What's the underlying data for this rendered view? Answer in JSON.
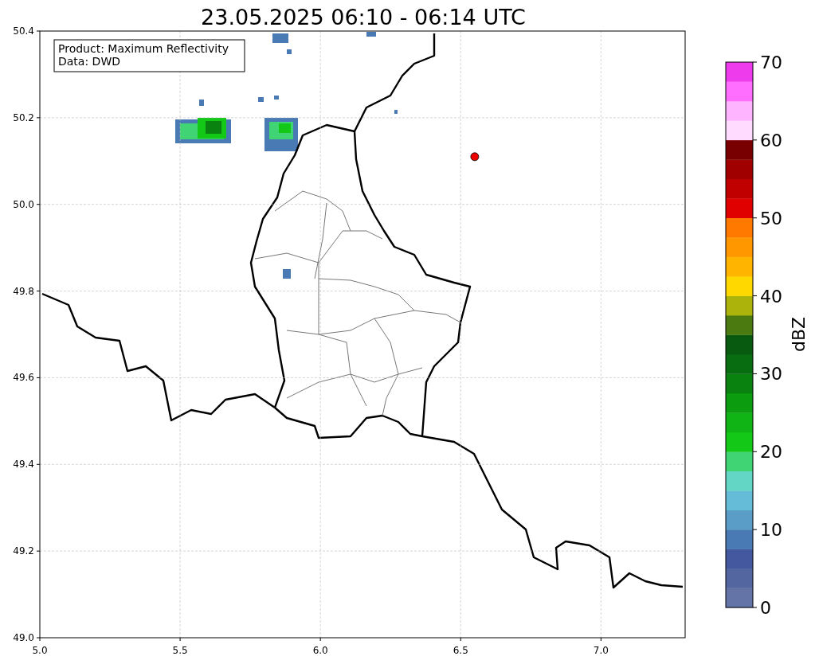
{
  "title": "23.05.2025 06:10 - 06:14 UTC",
  "info_box": {
    "lines": [
      "Product: Maximum Reflectivity",
      "Data: DWD"
    ]
  },
  "map": {
    "chart_data": {
      "type": "scatter",
      "grid": true,
      "x": [
        6.55
      ],
      "values": [
        50.11
      ],
      "xlim": [
        5.0,
        7.3
      ],
      "ylim": [
        49.0,
        50.4
      ],
      "xticks": [
        {
          "value": 5.0,
          "label": "5.0"
        },
        {
          "value": 5.5,
          "label": "5.5"
        },
        {
          "value": 6.0,
          "label": "6.0"
        },
        {
          "value": 6.5,
          "label": "6.5"
        },
        {
          "value": 7.0,
          "label": "7.0"
        }
      ],
      "yticks": [
        {
          "value": 49.0,
          "label": "49.0"
        },
        {
          "value": 49.2,
          "label": "49.2"
        },
        {
          "value": 49.4,
          "label": "49.4"
        },
        {
          "value": 49.6,
          "label": "49.6"
        },
        {
          "value": 49.8,
          "label": "49.8"
        },
        {
          "value": 50.0,
          "label": "50.0"
        },
        {
          "value": 50.2,
          "label": "50.2"
        },
        {
          "value": 50.4,
          "label": "50.4"
        }
      ]
    }
  },
  "colorbar": {
    "label": "dBZ",
    "ticks": [
      "70",
      "60",
      "50",
      "40",
      "30",
      "20",
      "10",
      "0"
    ],
    "segments": [
      {
        "color": "#6474a6"
      },
      {
        "color": "#5466a0"
      },
      {
        "color": "#4458a0"
      },
      {
        "color": "#4a7ab4"
      },
      {
        "color": "#5a9ec8"
      },
      {
        "color": "#64bcd8"
      },
      {
        "color": "#64d6c6"
      },
      {
        "color": "#40d474"
      },
      {
        "color": "#14c818"
      },
      {
        "color": "#10b414"
      },
      {
        "color": "#0c9c10"
      },
      {
        "color": "#0a8210"
      },
      {
        "color": "#086c10"
      },
      {
        "color": "#085a10"
      },
      {
        "color": "#4a7a10"
      },
      {
        "color": "#acb40c"
      },
      {
        "color": "#ffd800"
      },
      {
        "color": "#ffb400"
      },
      {
        "color": "#ff9800"
      },
      {
        "color": "#ff7800"
      },
      {
        "color": "#e00000"
      },
      {
        "color": "#c00000"
      },
      {
        "color": "#a00000"
      },
      {
        "color": "#780000"
      },
      {
        "color": "#ffdcff"
      },
      {
        "color": "#ffb4ff"
      },
      {
        "color": "#ff6eff"
      },
      {
        "color": "#ee3ced"
      }
    ]
  }
}
